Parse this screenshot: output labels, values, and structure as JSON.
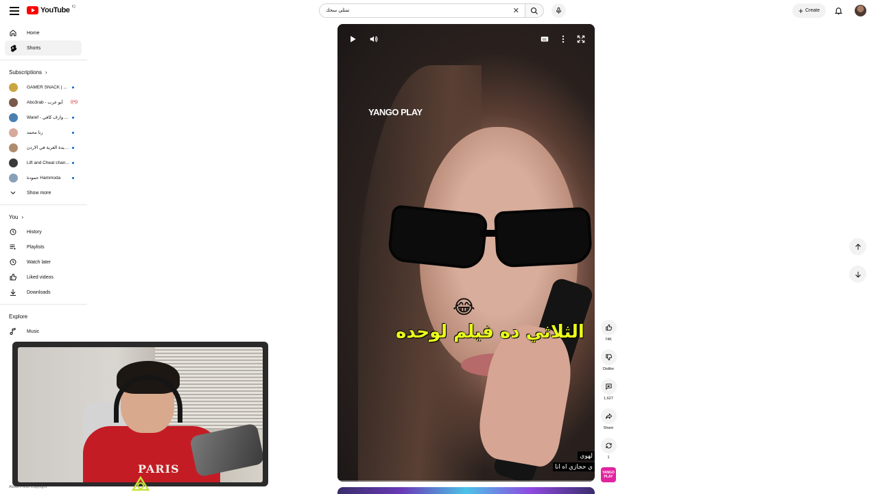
{
  "header": {
    "logo_text": "YouTube",
    "logo_country": "IQ",
    "search_value": "تمثلي سحك",
    "create_label": "Create"
  },
  "sidebar": {
    "home": "Home",
    "shorts": "Shorts",
    "subscriptions_title": "Subscriptions",
    "subscriptions": [
      {
        "name": "GAMER SNACK | ...",
        "color": "#c9a642"
      },
      {
        "name": "Abo3rab - أبو عرب",
        "color": "#7a5a4a",
        "live": "((•))"
      },
      {
        "name": "Waref - وارف كافي ...",
        "color": "#4a7fb0"
      },
      {
        "name": "رنا محمد",
        "color": "#d7a99c"
      },
      {
        "name": "جريدة الغربة في الاردن",
        "color": "#b08c6e"
      },
      {
        "name": "Lift and Cheat chan...",
        "color": "#3a3a3a"
      },
      {
        "name": "حمودة Hammoda",
        "color": "#8aa0b8"
      }
    ],
    "show_more": "Show more",
    "you_title": "You",
    "you_items": [
      "History",
      "Playlists",
      "Watch later",
      "Liked videos",
      "Downloads"
    ],
    "explore_title": "Explore",
    "explore_items": [
      "Music"
    ],
    "footer": "About   Press   Copyright"
  },
  "webcam": {
    "shirt_text": "PARIS"
  },
  "short": {
    "brand": "YANGO PLAY",
    "emoji": "😂",
    "caption": "الثلاثي ده فيلم لوحده",
    "subtitle_line1": "لهوي",
    "subtitle_line2": "ي حجازي اه انا",
    "progress": 0.0
  },
  "actions": {
    "like_count": "74K",
    "dislike_label": "Dislike",
    "comment_count": "1,627",
    "share_label": "Share",
    "remix_count": "1",
    "channel_badge": "YANGO PLAY"
  },
  "colors": {
    "brand_red": "#ff0000",
    "caption_yellow": "#eaff1a",
    "channel_pink": "#e0249f"
  }
}
